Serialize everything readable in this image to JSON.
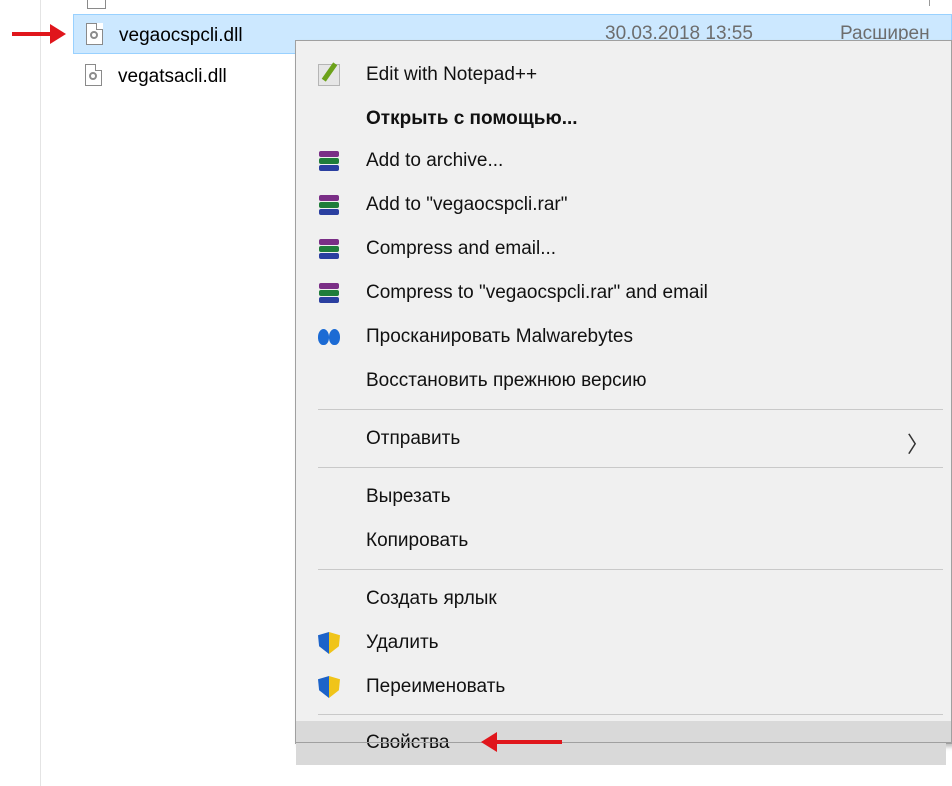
{
  "files": [
    {
      "name": "vegaocspcli.dll",
      "date": "30.03.2018 13:55",
      "type": "Расширен",
      "selected": true
    },
    {
      "name": "vegatsacli.dll",
      "selected": false
    }
  ],
  "menu": {
    "items": [
      {
        "label": "Edit with Notepad++",
        "icon": "notepad-plus-plus-icon"
      },
      {
        "label": "Открыть с помощью...",
        "bold": true
      },
      {
        "label": "Add to archive...",
        "icon": "winrar-icon"
      },
      {
        "label": "Add to \"vegaocspcli.rar\"",
        "icon": "winrar-icon"
      },
      {
        "label": "Compress and email...",
        "icon": "winrar-icon"
      },
      {
        "label": "Compress to \"vegaocspcli.rar\" and email",
        "icon": "winrar-icon"
      },
      {
        "label": "Просканировать Malwarebytes",
        "icon": "malwarebytes-icon"
      },
      {
        "label": "Восстановить прежнюю версию"
      },
      {
        "label": "Отправить",
        "submenu": true
      },
      {
        "label": "Вырезать"
      },
      {
        "label": "Копировать"
      },
      {
        "label": "Создать ярлык"
      },
      {
        "label": "Удалить",
        "icon": "uac-shield-icon"
      },
      {
        "label": "Переименовать",
        "icon": "uac-shield-icon"
      },
      {
        "label": "Свойства",
        "highlighted": true
      }
    ],
    "submenu_glyph": "〉"
  },
  "colors": {
    "selection_bg": "#cce8ff",
    "menu_bg": "#f0f0f0",
    "highlight_bg": "#d9d9d9",
    "annotation_arrow": "#e0161c"
  }
}
